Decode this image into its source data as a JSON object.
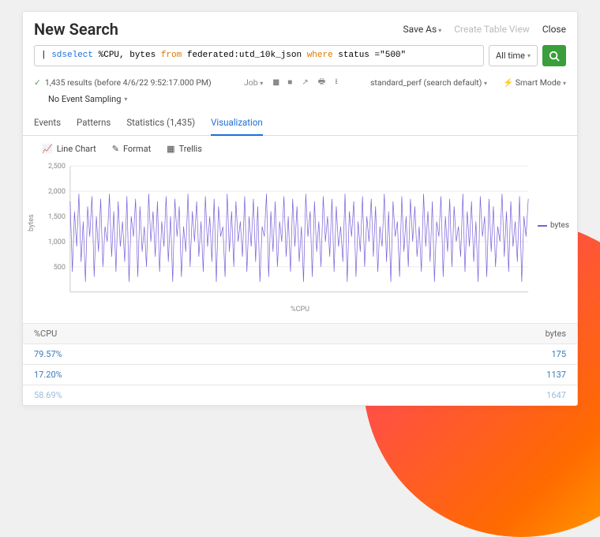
{
  "header": {
    "title": "New Search",
    "save_as": "Save As",
    "create_table": "Create Table View",
    "close": "Close"
  },
  "search": {
    "prefix": "| ",
    "kw_select": "sdselect",
    "fields": " %CPU, bytes ",
    "kw_from": "from",
    "source": " federated:utd_10k_json ",
    "kw_where": "where",
    "clause": "  status =\"500\"",
    "time_label": "All time",
    "search_aria": "Run search"
  },
  "status": {
    "results": "1,435 results (before 4/6/22 9:52:17.000 PM)",
    "sampling": "No Event Sampling",
    "job": "Job",
    "workload": "standard_perf (search default)",
    "mode": "Smart Mode"
  },
  "tabs": {
    "events": "Events",
    "patterns": "Patterns",
    "statistics": "Statistics (1,435)",
    "visualization": "Visualization"
  },
  "toolbar": {
    "line_chart": "Line Chart",
    "format": "Format",
    "trellis": "Trellis"
  },
  "chart_data": {
    "type": "line",
    "title": "",
    "xlabel": "%CPU",
    "ylabel": "bytes",
    "ylim": [
      0,
      2500
    ],
    "yticks": [
      500,
      1000,
      1500,
      2000,
      2500
    ],
    "series": [
      {
        "name": "bytes",
        "values": [
          1800,
          400,
          1600,
          900,
          1950,
          600,
          1400,
          200,
          1700,
          1100,
          1900,
          300,
          1500,
          800,
          1850,
          500,
          1300,
          1000,
          1950,
          700,
          1600,
          400,
          1800,
          900,
          1400,
          600,
          1900,
          200,
          1500,
          1100,
          1850,
          300,
          1700,
          800,
          1300,
          500,
          1950,
          1000,
          1600,
          700,
          1800,
          400,
          1400,
          900,
          1900,
          600,
          1500,
          200,
          1850,
          1100,
          1700,
          300,
          1300,
          800,
          1950,
          500,
          1600,
          1000,
          1800,
          700,
          1400,
          400,
          1900,
          900,
          1500,
          600,
          1850,
          200,
          1700,
          1100,
          1300,
          300,
          1950,
          800,
          1600,
          500,
          1800,
          1000,
          1400,
          700,
          1900,
          400,
          1500,
          900,
          1850,
          600,
          1700,
          200,
          1300,
          1100,
          1950,
          300,
          1600,
          800,
          1800,
          500,
          1400,
          1000,
          1900,
          700,
          1500,
          400,
          1850,
          900,
          1700,
          600,
          1300,
          200,
          1950,
          1100,
          1600,
          300,
          1800,
          800,
          1400,
          500,
          1900,
          1000,
          1500,
          700,
          1850,
          400,
          1700,
          900,
          1300,
          600,
          1950,
          200,
          1600,
          1100,
          1800,
          300,
          1400,
          800,
          1900,
          500,
          1500,
          1000,
          1850,
          700,
          1700,
          400,
          1300,
          900,
          1950,
          600,
          1600,
          200,
          1800,
          1100,
          1400,
          300,
          1900,
          800,
          1500,
          500,
          1850,
          1000,
          1700,
          700,
          1300,
          400,
          1950,
          900,
          1600,
          600,
          1800,
          200,
          1400,
          1100,
          1900,
          300,
          1500,
          800,
          1850,
          500,
          1700,
          1000,
          1300,
          700,
          1950,
          400,
          1600,
          900,
          1800,
          600,
          1400,
          200,
          1900,
          1100,
          1500,
          300,
          1850,
          800,
          1700,
          500,
          1300,
          1000,
          1950,
          700,
          1600,
          400,
          1800,
          900,
          1400,
          600,
          1900,
          200,
          1500,
          1100,
          1850
        ]
      }
    ]
  },
  "table": {
    "col_cpu": "%CPU",
    "col_bytes": "bytes",
    "rows": [
      {
        "cpu": "79.57%",
        "bytes": "175"
      },
      {
        "cpu": "17.20%",
        "bytes": "1137"
      },
      {
        "cpu": "58.69%",
        "bytes": "1647"
      }
    ]
  }
}
